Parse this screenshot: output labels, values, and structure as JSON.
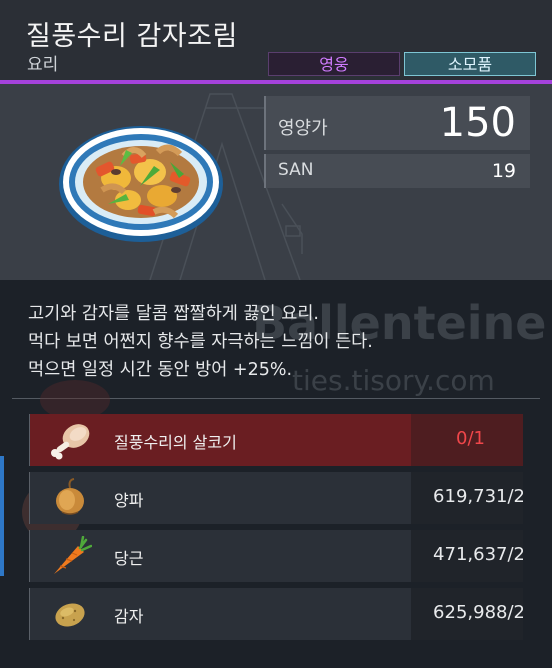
{
  "item": {
    "title": "질풍수리 감자조림",
    "category": "요리"
  },
  "tabs": [
    {
      "label": "영웅"
    },
    {
      "label": "소모품"
    }
  ],
  "stats": {
    "nutrition": {
      "label": "영양가",
      "value": "150"
    },
    "san": {
      "label": "SAN",
      "value": "19"
    }
  },
  "description": [
    "고기와 감자를 달콤 짭짤하게 끓인 요리.",
    "먹다 보면 어쩐지 향수를 자극하는 느낌이 든다.",
    "먹으면 일정 시간 동안 방어 +25%."
  ],
  "watermark": {
    "line1": "Ballenteine",
    "line2": "ties.tisory.com"
  },
  "ingredients": [
    {
      "name": "질풍수리의 살코기",
      "count": "0/1",
      "icon": "meat-leg-icon",
      "missing": true
    },
    {
      "name": "양파",
      "count": "619,731/2",
      "icon": "onion-icon",
      "missing": false
    },
    {
      "name": "당근",
      "count": "471,637/2",
      "icon": "carrot-icon",
      "missing": false
    },
    {
      "name": "감자",
      "count": "625,988/2",
      "icon": "potato-icon",
      "missing": false
    }
  ],
  "colors": {
    "accent_purple": "#a542dc",
    "tab_hero_text": "#d07cff",
    "tab_consumable_bg": "#2f5a66",
    "missing_red": "#f0464a",
    "missing_row": "#6a1e22"
  }
}
